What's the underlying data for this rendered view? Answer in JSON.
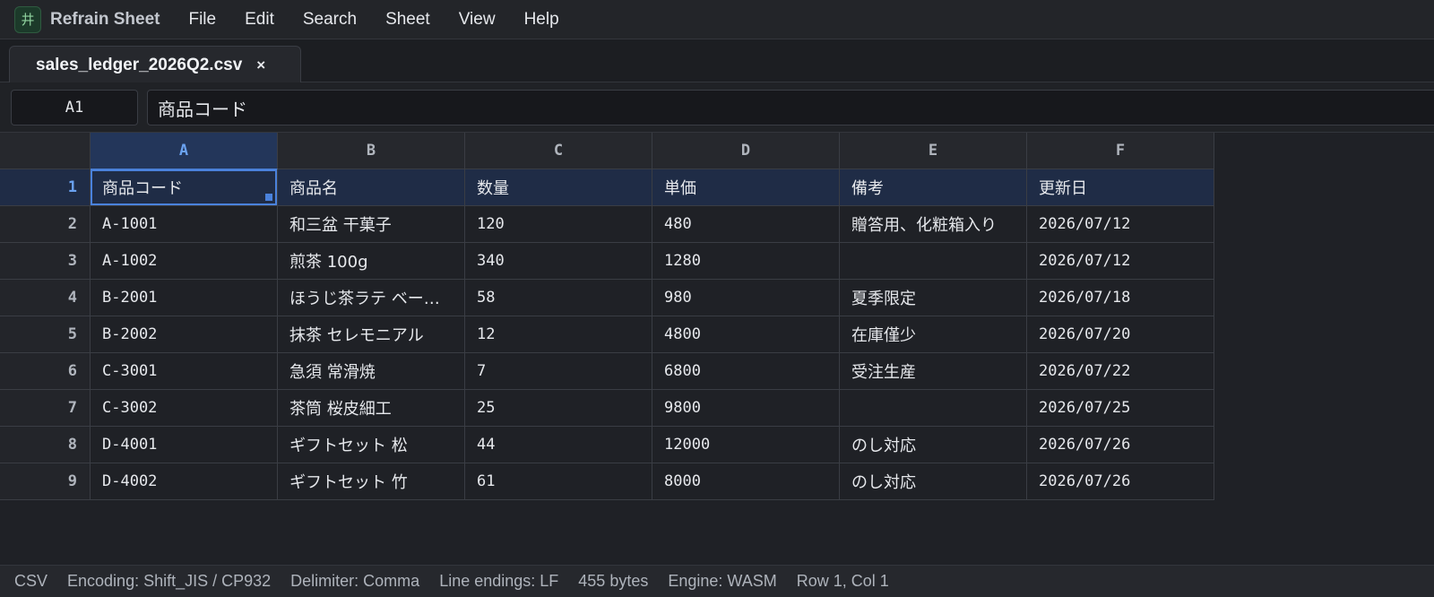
{
  "app": {
    "logo_glyph": "井",
    "name": "Refrain Sheet"
  },
  "menu": [
    "File",
    "Edit",
    "Search",
    "Sheet",
    "View",
    "Help"
  ],
  "tab": {
    "title": "sales_ledger_2026Q2.csv",
    "close": "×"
  },
  "formula_bar": {
    "cell_ref": "A1",
    "content": "商品コード"
  },
  "grid": {
    "columns": [
      "A",
      "B",
      "C",
      "D",
      "E",
      "F"
    ],
    "active_column": "A",
    "active_row": 1,
    "rows": [
      {
        "num": "1",
        "cells": [
          "商品コード",
          "商品名",
          "数量",
          "単価",
          "備考",
          "更新日"
        ]
      },
      {
        "num": "2",
        "cells": [
          "A-1001",
          "和三盆 干菓子",
          "120",
          "480",
          "贈答用、化粧箱入り",
          "2026/07/12"
        ]
      },
      {
        "num": "3",
        "cells": [
          "A-1002",
          "煎茶 100g",
          "340",
          "1280",
          "",
          "2026/07/12"
        ]
      },
      {
        "num": "4",
        "cells": [
          "B-2001",
          "ほうじ茶ラテ ベー…",
          "58",
          "980",
          "夏季限定",
          "2026/07/18"
        ]
      },
      {
        "num": "5",
        "cells": [
          "B-2002",
          "抹茶 セレモニアル",
          "12",
          "4800",
          "在庫僅少",
          "2026/07/20"
        ]
      },
      {
        "num": "6",
        "cells": [
          "C-3001",
          "急須 常滑焼",
          "7",
          "6800",
          "受注生産",
          "2026/07/22"
        ]
      },
      {
        "num": "7",
        "cells": [
          "C-3002",
          "茶筒 桜皮細工",
          "25",
          "9800",
          "",
          "2026/07/25"
        ]
      },
      {
        "num": "8",
        "cells": [
          "D-4001",
          "ギフトセット 松",
          "44",
          "12000",
          "のし対応",
          "2026/07/26"
        ]
      },
      {
        "num": "9",
        "cells": [
          "D-4002",
          "ギフトセット 竹",
          "61",
          "8000",
          "のし対応",
          "2026/07/26"
        ]
      }
    ]
  },
  "status": [
    "CSV",
    "Encoding: Shift_JIS / CP932",
    "Delimiter: Comma",
    "Line endings: LF",
    "455 bytes",
    "Engine: WASM",
    "Row 1, Col 1"
  ],
  "colors": {
    "accent": "#4a82dc",
    "background": "#1f2126"
  }
}
